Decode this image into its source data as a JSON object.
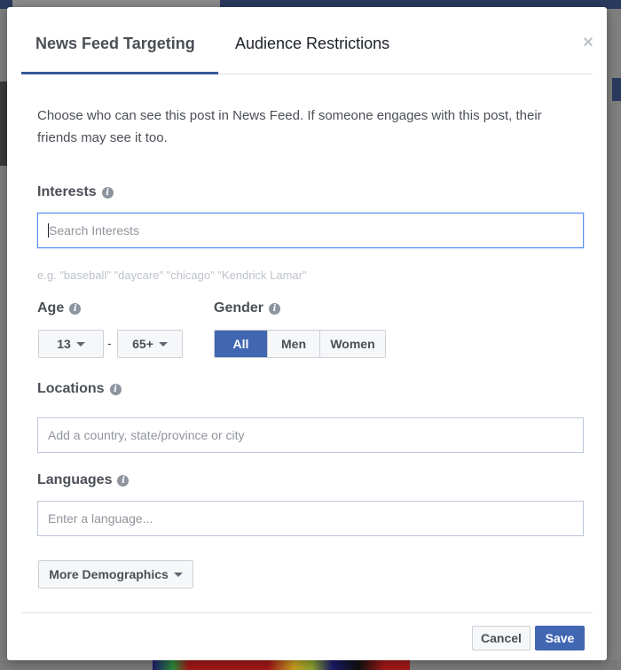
{
  "tabs": [
    {
      "label": "News Feed Targeting",
      "active": true
    },
    {
      "label": "Audience Restrictions",
      "active": false
    }
  ],
  "close_icon": "close-icon",
  "description": "Choose who can see this post in News Feed. If someone engages with this post, their friends may see it too.",
  "interests": {
    "label": "Interests",
    "placeholder": "Search Interests",
    "hint": "e.g. \"baseball\" \"daycare\" \"chicago\" \"Kendrick Lamar\""
  },
  "age": {
    "label": "Age",
    "min": "13",
    "max": "65+",
    "separator": "-"
  },
  "gender": {
    "label": "Gender",
    "options": [
      "All",
      "Men",
      "Women"
    ],
    "selected": "All"
  },
  "locations": {
    "label": "Locations",
    "placeholder": "Add a country, state/province or city"
  },
  "languages": {
    "label": "Languages",
    "placeholder": "Enter a language..."
  },
  "more_demographics": {
    "label": "More Demographics"
  },
  "footer": {
    "cancel_label": "Cancel",
    "save_label": "Save"
  },
  "colors": {
    "accent": "#4267b2",
    "tab_underline": "#365899",
    "focus_border": "#5b93f3"
  }
}
